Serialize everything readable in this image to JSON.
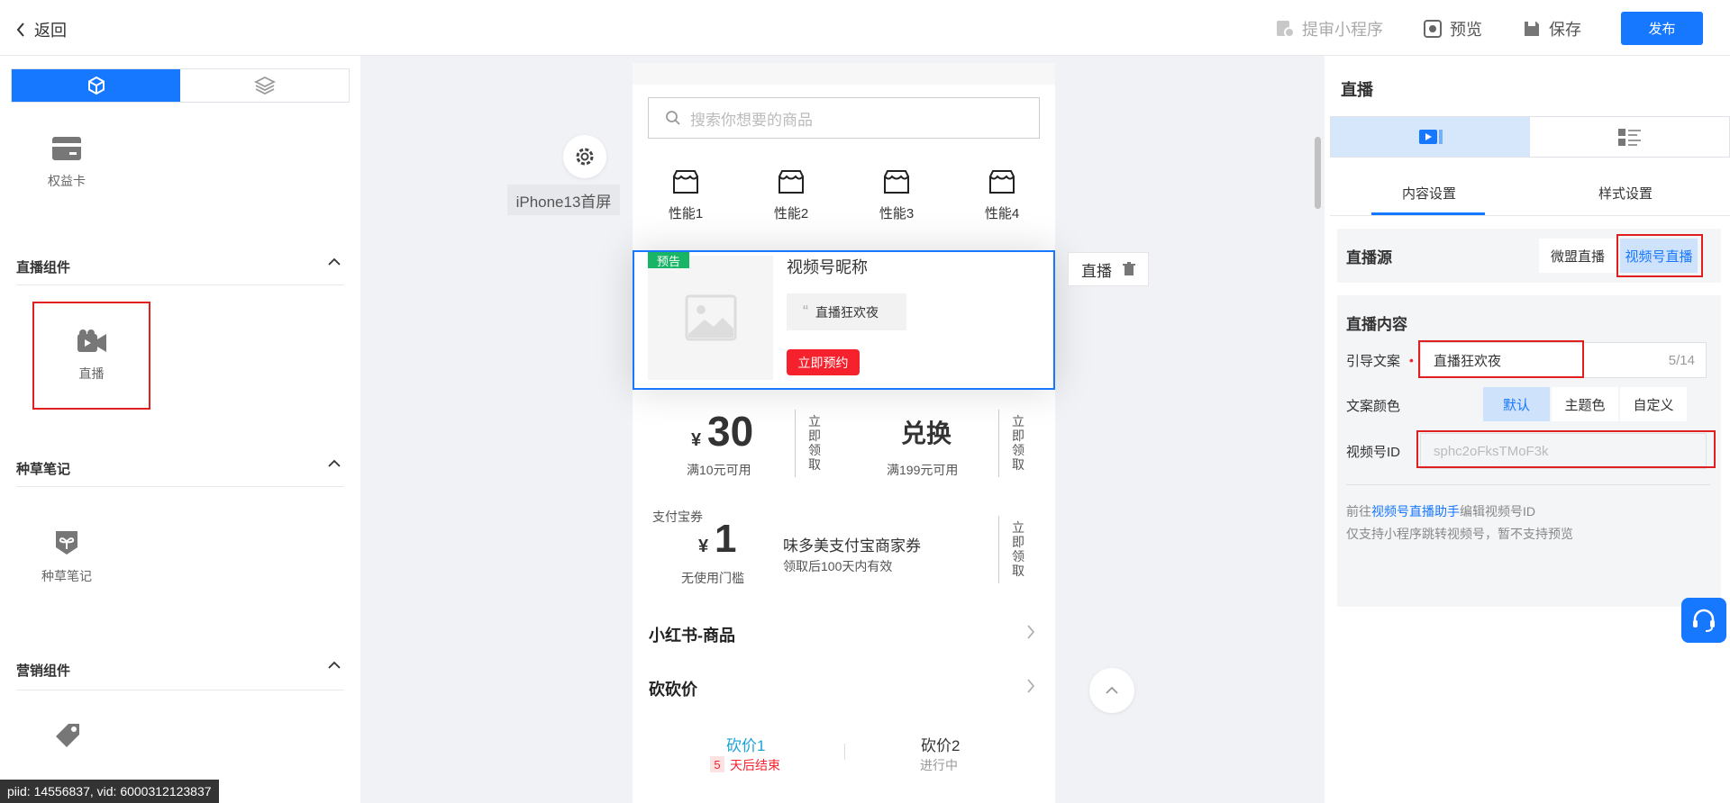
{
  "topbar": {
    "back_label": "返回",
    "submit_label": "提审小程序",
    "preview_label": "预览",
    "save_label": "保存",
    "publish_label": "发布"
  },
  "left_panel": {
    "benefit_card_label": "权益卡",
    "live_section_title": "直播组件",
    "live_label": "直播",
    "notes_section_title": "种草笔记",
    "notes_label": "种草笔记",
    "marketing_section_title": "营销组件"
  },
  "canvas": {
    "page_label": "iPhone13首屏",
    "search_placeholder": "搜索你想要的商品",
    "categories": [
      "性能1",
      "性能2",
      "性能3",
      "性能4"
    ],
    "live_card": {
      "tag": "预告",
      "name": "视频号昵称",
      "quote": "直播狂欢夜",
      "reserve_button": "立即预约"
    },
    "float_tag_label": "直播",
    "coupons": {
      "currency": "¥",
      "c1_amount": "30",
      "c1_condition": "满10元可用",
      "c1_action": "立即领取",
      "c2_title": "兑换",
      "c2_condition": "满199元可用",
      "c2_action": "立即领取",
      "alipay_label": "支付宝券",
      "c3_amount": "1",
      "c3_condition": "无使用门槛",
      "c3_title": "味多美支付宝商家券",
      "c3_desc": "领取后100天内有效",
      "c3_action": "立即领取"
    },
    "row1_title": "小红书-商品",
    "row2_title": "砍砍价",
    "bargain1_title": "砍价1",
    "bargain1_days": "5",
    "bargain1_status": "天后结束",
    "bargain2_title": "砍价2",
    "bargain2_status": "进行中"
  },
  "right_panel": {
    "title": "直播",
    "subtab_content": "内容设置",
    "subtab_style": "样式设置",
    "source_label": "直播源",
    "source_options": [
      "微盟直播",
      "视频号直播"
    ],
    "content_title": "直播内容",
    "guide_label": "引导文案",
    "guide_value": "直播狂欢夜",
    "guide_count": "5/14",
    "color_label": "文案颜色",
    "color_options": [
      "默认",
      "主题色",
      "自定义"
    ],
    "channel_id_label": "视频号ID",
    "channel_id_placeholder": "sphc2oFksTMoF3k",
    "hint_prefix": "前往",
    "hint_link": "视频号直播助手",
    "hint_suffix": "编辑视频号ID",
    "hint_line2": "仅支持小程序跳转视频号，暂不支持预览"
  },
  "footer_id": "piid: 14556837, vid: 6000312123837",
  "colors": {
    "primary": "#1677ff",
    "danger": "#f5222d",
    "green_tag": "#18b566",
    "highlight_border": "#e02020"
  }
}
